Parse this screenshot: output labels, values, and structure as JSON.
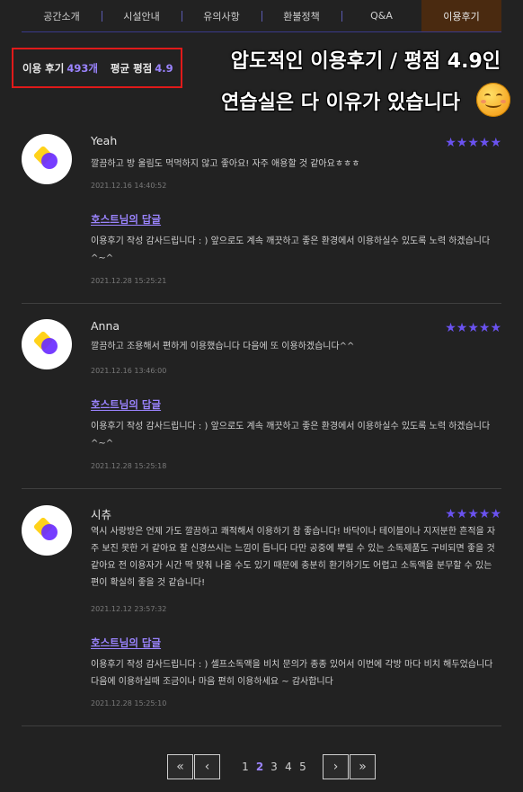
{
  "tabs": [
    {
      "label": "공간소개",
      "active": false
    },
    {
      "label": "시설안내",
      "active": false
    },
    {
      "label": "유의사항",
      "active": false
    },
    {
      "label": "환불정책",
      "active": false
    },
    {
      "label": "Q&A",
      "active": false
    },
    {
      "label": "이용후기",
      "active": true
    }
  ],
  "summary": {
    "review_label": "이용 후기",
    "review_count": "493개",
    "rating_label": "평균 평점",
    "rating_value": "4.9"
  },
  "promo": {
    "line1": "압도적인 이용후기 / 평점 4.9인",
    "line2": "연습실은 다 이유가 있습니다",
    "emoji": "smiling-face-icon"
  },
  "colors": {
    "accent": "#9b84ff",
    "star": "#6a52f0",
    "active_tab_bg": "#4a2a10",
    "highlight_border": "#e01a1a"
  },
  "reviews": [
    {
      "name": "Yeah",
      "stars": "★★★★★",
      "text": "깔끔하고 방 울림도 먹먹하지 않고 좋아요! 자주 애용할 것 같아요ㅎㅎㅎ",
      "date": "2021.12.16 14:40:52",
      "reply_title": "호스트님의 답글",
      "reply_text": "이용후기 작성 감사드립니다 : ) 앞으로도 계속 깨끗하고 좋은 환경에서 이용하실수 있도록 노력 하겠습니다 ^~^",
      "reply_date": "2021.12.28 15:25:21"
    },
    {
      "name": "Anna",
      "stars": "★★★★★",
      "text": "깔끔하고 조용해서 편하게 이용했습니다 다음에 또 이용하겠습니다^^",
      "date": "2021.12.16 13:46:00",
      "reply_title": "호스트님의 답글",
      "reply_text": "이용후기 작성 감사드립니다 : ) 앞으로도 계속 깨끗하고 좋은 환경에서 이용하실수 있도록 노력 하겠습니다 ^~^",
      "reply_date": "2021.12.28 15:25:18"
    },
    {
      "name": "시츄",
      "stars": "★★★★★",
      "text": "역시 사랑방은 언제 가도 깔끔하고 쾌적해서 이용하기 참 좋습니다! 바닥이나 테이블이나 지저분한 흔적을 자주 보진 못한 거 같아요 잘 신경쓰시는 느낌이 듭니다 다만 공중에 뿌릴 수 있는 소독제품도 구비되면 좋을 것 같아요 전 이용자가 시간 딱 맞춰 나올 수도 있기 때문에 충분히 환기하기도 어렵고 소독액을 분무할 수 있는 편이 확실히 좋을 것 같습니다!",
      "date": "2021.12.12 23:57:32",
      "reply_title": "호스트님의 답글",
      "reply_text": "이용후기 작성 감사드립니다 : ) 셀프소독액을 비치 문의가 종종 있어서 이번에 각방 마다 비치 해두었습니다 다음에 이용하실때 조금이나 마음 편히 이용하세요 ~ 감사합니다",
      "reply_date": "2021.12.28 15:25:10"
    }
  ],
  "pagination": {
    "first": "«",
    "prev": "‹",
    "next": "›",
    "last": "»",
    "pages": [
      "1",
      "2",
      "3",
      "4",
      "5"
    ],
    "current": "2"
  }
}
